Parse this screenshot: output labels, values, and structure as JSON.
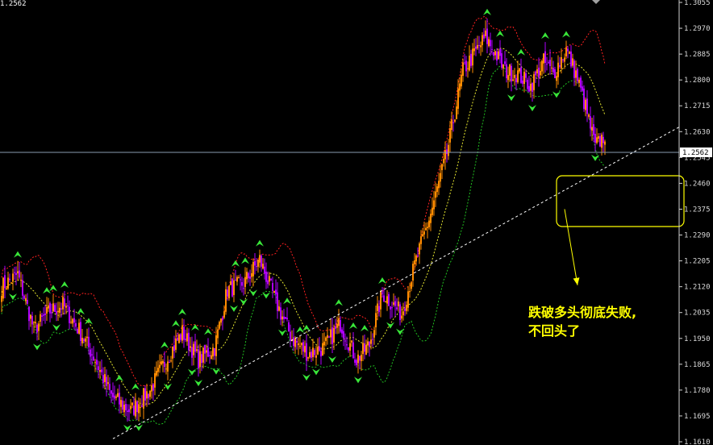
{
  "corner_label": "1.2562",
  "annotation": {
    "line1": "跌破多头彻底失败,",
    "line2": "不回头了"
  },
  "chart_data": {
    "type": "candlestick",
    "title": "",
    "ylim": [
      1.161,
      1.3055
    ],
    "ticks": [
      "1.3055",
      "1.2970",
      "1.2885",
      "1.2800",
      "1.2715",
      "1.2630",
      "1.2545",
      "1.2460",
      "1.2375",
      "1.2290",
      "1.2205",
      "1.2120",
      "1.2035",
      "1.1950",
      "1.1865",
      "1.1780",
      "1.1695",
      "1.1610"
    ],
    "current_price": 1.2562,
    "current_price_label": "1.2562",
    "colors": {
      "background": "#000000",
      "bull": "#ff8c00",
      "bear": "#b000ff",
      "upper_band": "#ff2020",
      "middle_band": "#e8e830",
      "lower_band": "#20c020",
      "arrow": "#39e639",
      "trendline": "#ffffff",
      "annotation": "#ffff00"
    },
    "waypoints": [
      [
        0,
        1.212
      ],
      [
        10,
        1.216
      ],
      [
        20,
        1.198
      ],
      [
        30,
        1.204
      ],
      [
        38,
        1.206
      ],
      [
        50,
        1.196
      ],
      [
        58,
        1.188
      ],
      [
        68,
        1.176
      ],
      [
        80,
        1.171
      ],
      [
        92,
        1.178
      ],
      [
        102,
        1.188
      ],
      [
        112,
        1.197
      ],
      [
        122,
        1.188
      ],
      [
        132,
        1.192
      ],
      [
        140,
        1.211
      ],
      [
        150,
        1.213
      ],
      [
        160,
        1.221
      ],
      [
        170,
        1.207
      ],
      [
        180,
        1.195
      ],
      [
        190,
        1.19
      ],
      [
        200,
        1.192
      ],
      [
        210,
        1.2
      ],
      [
        220,
        1.188
      ],
      [
        228,
        1.193
      ],
      [
        236,
        1.21
      ],
      [
        248,
        1.203
      ],
      [
        256,
        1.219
      ],
      [
        266,
        1.236
      ],
      [
        276,
        1.256
      ],
      [
        286,
        1.283
      ],
      [
        296,
        1.291
      ],
      [
        300,
        1.294
      ],
      [
        306,
        1.289
      ],
      [
        312,
        1.283
      ],
      [
        320,
        1.282
      ],
      [
        328,
        1.278
      ],
      [
        336,
        1.286
      ],
      [
        342,
        1.282
      ],
      [
        350,
        1.29
      ],
      [
        356,
        1.282
      ],
      [
        362,
        1.271
      ],
      [
        368,
        1.258
      ],
      [
        374,
        1.262
      ]
    ],
    "highlight_box": {
      "x0": 344,
      "x1": 423,
      "y_top": 1.2485,
      "y_bottom": 1.2318
    }
  }
}
